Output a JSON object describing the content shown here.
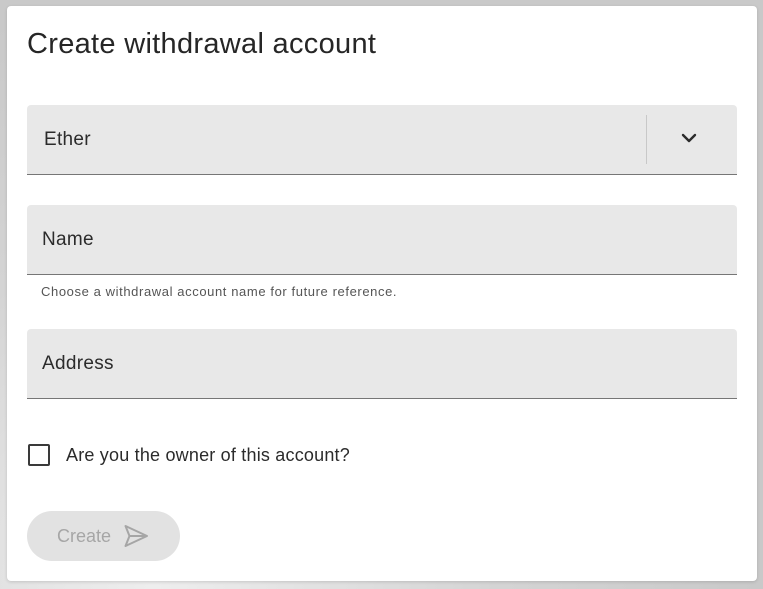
{
  "form": {
    "title": "Create withdrawal account",
    "currency_select": {
      "selected": "Ether",
      "icon": "chevron-down-icon"
    },
    "name_field": {
      "label": "Name",
      "helper_text": "Choose a withdrawal account name for future reference."
    },
    "address_field": {
      "label": "Address"
    },
    "owner_checkbox": {
      "label": "Are you the owner of this account?",
      "checked": false
    },
    "create_button": {
      "label": "Create",
      "icon": "send-icon",
      "disabled": true
    }
  },
  "colors": {
    "field_bg": "#e8e8e8",
    "button_disabled_bg": "#e2e2e2",
    "button_disabled_text": "#a6a6a6"
  }
}
